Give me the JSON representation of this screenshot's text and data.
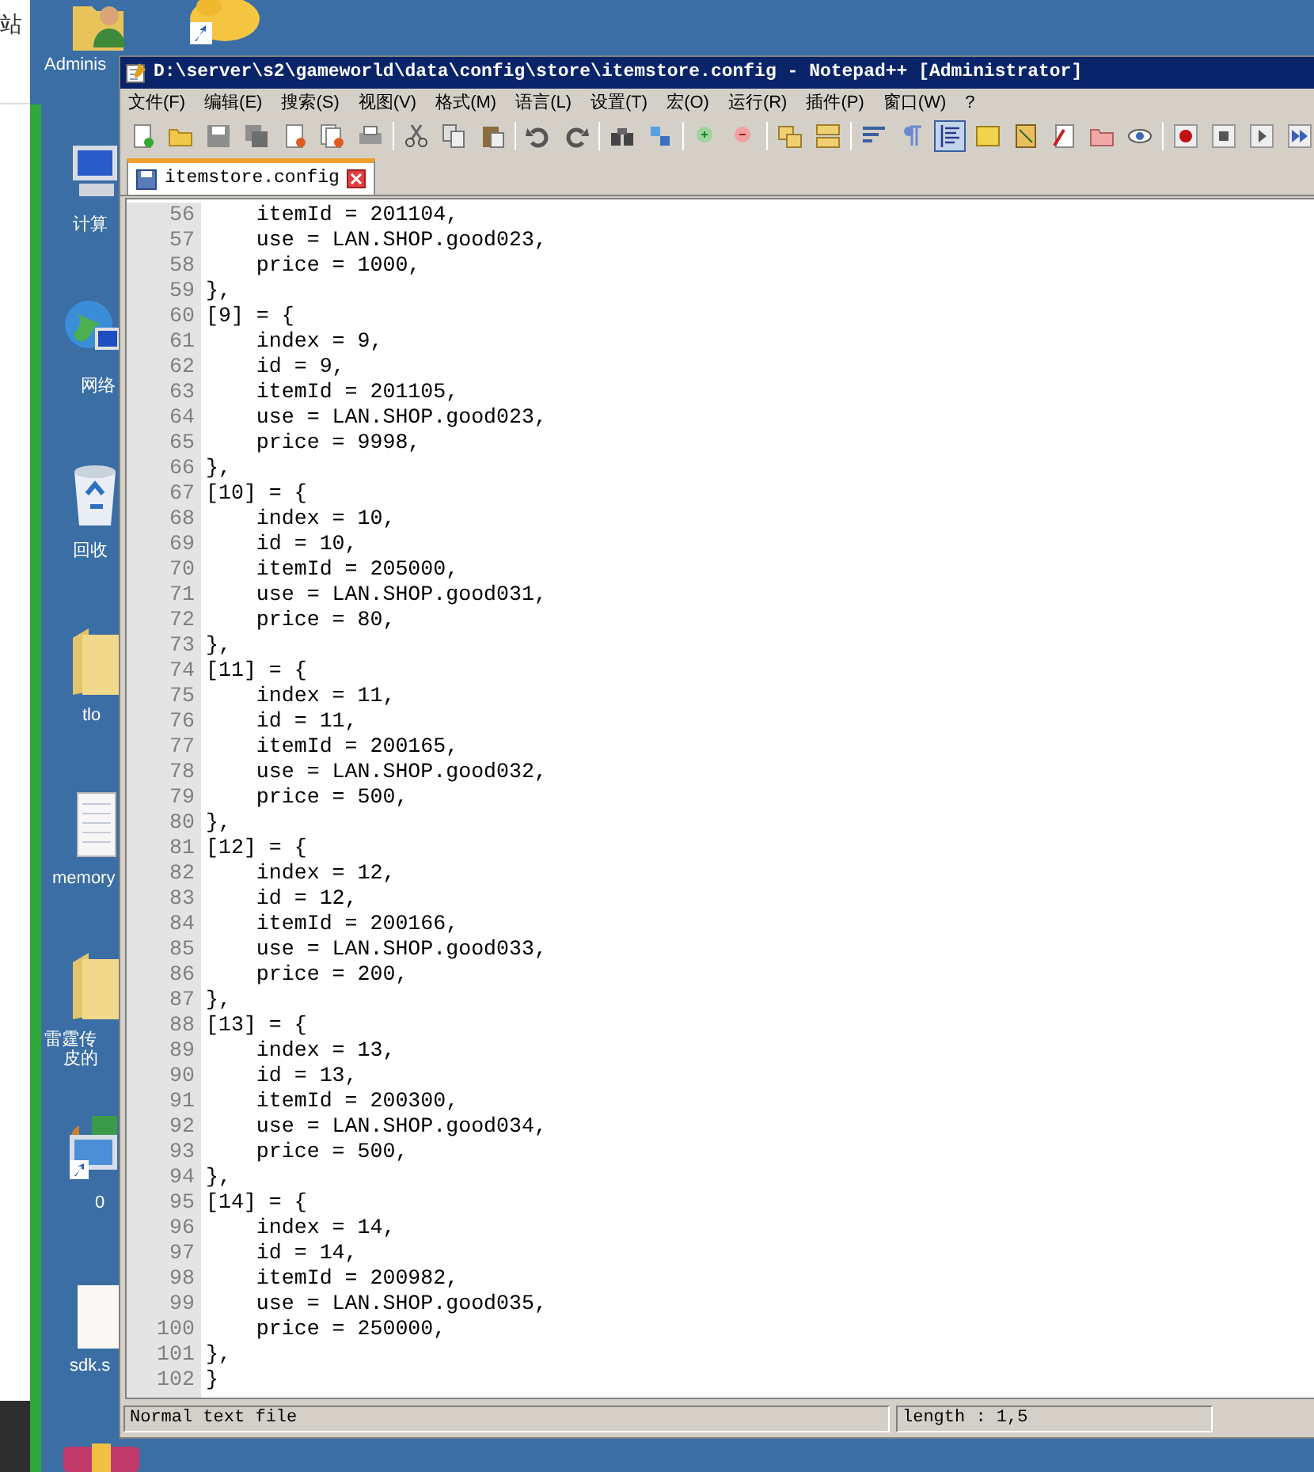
{
  "browser_fragment": {
    "text": "站"
  },
  "desktop": {
    "icons": [
      {
        "kind": "user-folder",
        "label": "Adminis"
      },
      {
        "kind": "yellow-shortcut"
      },
      {
        "kind": "computer",
        "label": "计算"
      },
      {
        "kind": "globe",
        "label": "网络"
      },
      {
        "kind": "recycle-bin",
        "label": "回收"
      },
      {
        "kind": "folder",
        "label": "tlo"
      },
      {
        "kind": "document",
        "label": "memory"
      },
      {
        "kind": "folder",
        "label": "雷霆传",
        "label_2": "皮的"
      },
      {
        "kind": "shortcut",
        "label": "0"
      },
      {
        "kind": "blank-file",
        "label": "sdk.s"
      },
      {
        "kind": "archive"
      }
    ]
  },
  "window": {
    "title": "D:\\server\\s2\\gameworld\\data\\config\\store\\itemstore.config - Notepad++ [Administrator]",
    "menu": [
      "文件(F)",
      "编辑(E)",
      "搜索(S)",
      "视图(V)",
      "格式(M)",
      "语言(L)",
      "设置(T)",
      "宏(O)",
      "运行(R)",
      "插件(P)",
      "窗口(W)",
      "?"
    ],
    "tabs": [
      {
        "label": "itemstore.config",
        "selected": true
      }
    ],
    "editor": {
      "lines": [
        {
          "number": "56",
          "text": "    itemId = 201104,"
        },
        {
          "number": "57",
          "text": "    use = LAN.SHOP.good023,"
        },
        {
          "number": "58",
          "text": "    price = 1000,"
        },
        {
          "number": "59",
          "text": "},"
        },
        {
          "number": "60",
          "text": "[9] = {"
        },
        {
          "number": "61",
          "text": "    index = 9,"
        },
        {
          "number": "62",
          "text": "    id = 9,"
        },
        {
          "number": "63",
          "text": "    itemId = 201105,"
        },
        {
          "number": "64",
          "text": "    use = LAN.SHOP.good023,"
        },
        {
          "number": "65",
          "text": "    price = 9998,"
        },
        {
          "number": "66",
          "text": "},"
        },
        {
          "number": "67",
          "text": "[10] = {"
        },
        {
          "number": "68",
          "text": "    index = 10,"
        },
        {
          "number": "69",
          "text": "    id = 10,"
        },
        {
          "number": "70",
          "text": "    itemId = 205000,"
        },
        {
          "number": "71",
          "text": "    use = LAN.SHOP.good031,"
        },
        {
          "number": "72",
          "text": "    price = 80,"
        },
        {
          "number": "73",
          "text": "},"
        },
        {
          "number": "74",
          "text": "[11] = {"
        },
        {
          "number": "75",
          "text": "    index = 11,"
        },
        {
          "number": "76",
          "text": "    id = 11,"
        },
        {
          "number": "77",
          "text": "    itemId = 200165,"
        },
        {
          "number": "78",
          "text": "    use = LAN.SHOP.good032,"
        },
        {
          "number": "79",
          "text": "    price = 500,"
        },
        {
          "number": "80",
          "text": "},"
        },
        {
          "number": "81",
          "text": "[12] = {"
        },
        {
          "number": "82",
          "text": "    index = 12,"
        },
        {
          "number": "83",
          "text": "    id = 12,"
        },
        {
          "number": "84",
          "text": "    itemId = 200166,"
        },
        {
          "number": "85",
          "text": "    use = LAN.SHOP.good033,"
        },
        {
          "number": "86",
          "text": "    price = 200,"
        },
        {
          "number": "87",
          "text": "},"
        },
        {
          "number": "88",
          "text": "[13] = {"
        },
        {
          "number": "89",
          "text": "    index = 13,"
        },
        {
          "number": "90",
          "text": "    id = 13,"
        },
        {
          "number": "91",
          "text": "    itemId = 200300,"
        },
        {
          "number": "92",
          "text": "    use = LAN.SHOP.good034,"
        },
        {
          "number": "93",
          "text": "    price = 500,"
        },
        {
          "number": "94",
          "text": "},"
        },
        {
          "number": "95",
          "text": "[14] = {"
        },
        {
          "number": "96",
          "text": "    index = 14,"
        },
        {
          "number": "97",
          "text": "    id = 14,"
        },
        {
          "number": "98",
          "text": "    itemId = 200982,"
        },
        {
          "number": "99",
          "text": "    use = LAN.SHOP.good035,"
        },
        {
          "number": "100",
          "text": "    price = 250000,"
        },
        {
          "number": "101",
          "text": "},"
        },
        {
          "number": "102",
          "text": "}"
        }
      ]
    },
    "status_bar": [
      "Normal text file",
      "length : 1,5"
    ]
  }
}
